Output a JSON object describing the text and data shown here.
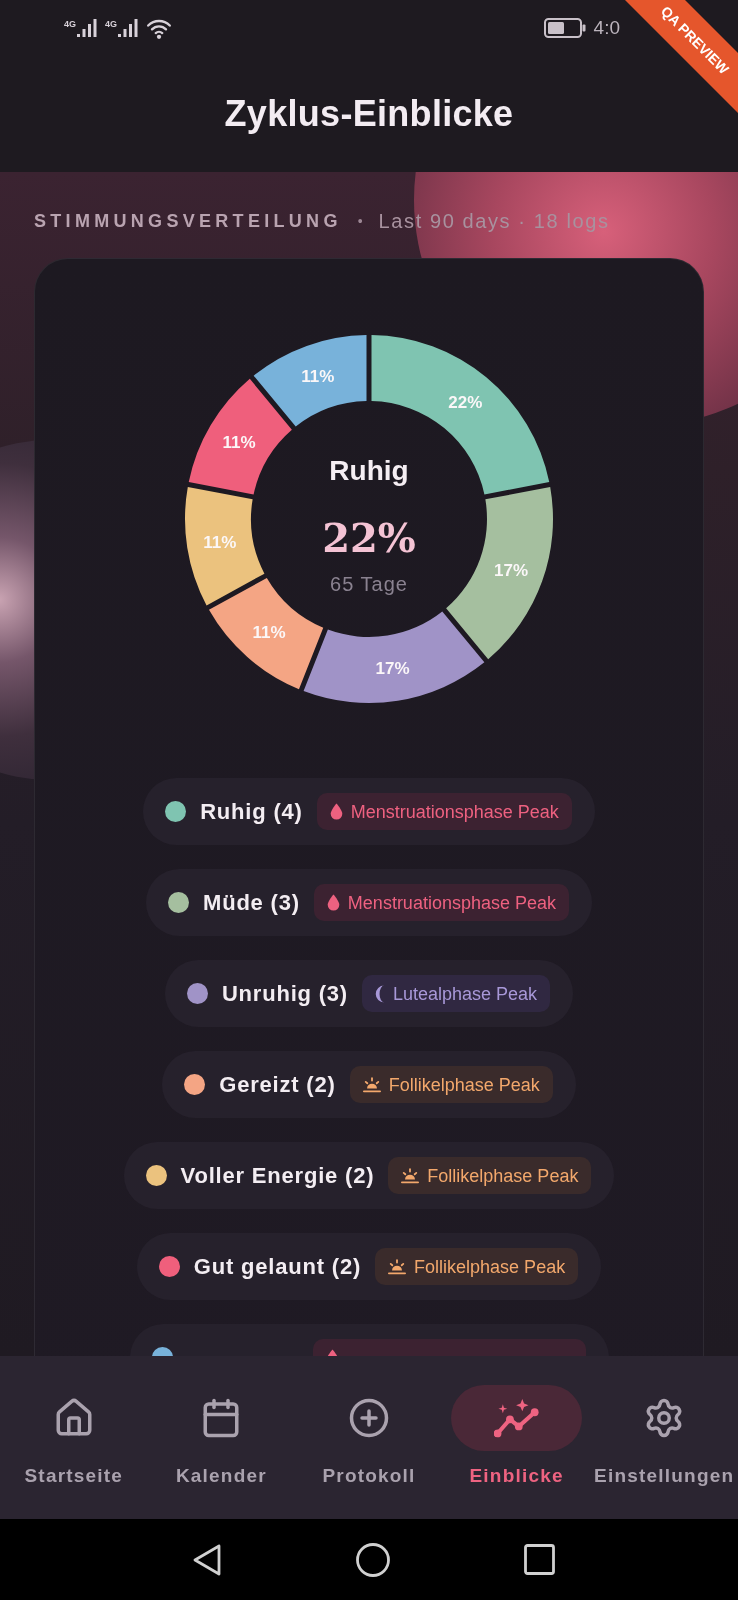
{
  "status_bar": {
    "networks": [
      {
        "label": "4G"
      },
      {
        "label": "4G"
      }
    ],
    "time": "4:0"
  },
  "debug_ribbon": "QA PREVIEW",
  "header": {
    "title": "Zyklus-Einblicke"
  },
  "section": {
    "title": "STIMMUNGSVERTEILUNG",
    "separator": "•",
    "meta": "Last 90 days · 18 logs"
  },
  "chart": {
    "center": {
      "label": "Ruhig",
      "percent": "22%",
      "detail": "65 Tage"
    },
    "chart_data": {
      "type": "donut",
      "values": [
        22,
        17,
        17,
        11,
        11,
        11,
        11
      ],
      "value_labels": [
        "22%",
        "17%",
        "17%",
        "11%",
        "11%",
        "11%",
        "11%"
      ]
    }
  },
  "legend": [
    {
      "label": "Ruhig (4)",
      "color": "#7fc4b1",
      "phase": {
        "kind": "menstrual",
        "label": "Menstruationsphase Peak"
      }
    },
    {
      "label": "Müde (3)",
      "color": "#a5bf9f",
      "phase": {
        "kind": "menstrual",
        "label": "Menstruationsphase Peak"
      }
    },
    {
      "label": "Unruhig (3)",
      "color": "#a093c7",
      "phase": {
        "kind": "luteal",
        "label": "Lutealphase Peak"
      }
    },
    {
      "label": "Gereizt (2)",
      "color": "#f4a584",
      "phase": {
        "kind": "follicular",
        "label": "Follikelphase Peak"
      }
    },
    {
      "label": "Voller Energie (2)",
      "color": "#ebc27e",
      "phase": {
        "kind": "follicular",
        "label": "Follikelphase Peak"
      }
    },
    {
      "label": "Gut gelaunt (2)",
      "color": "#ef5f7c",
      "phase": {
        "kind": "follicular",
        "label": "Follikelphase Peak"
      }
    },
    {
      "color": "#78b2da",
      "phase": {
        "kind": "menstrual"
      }
    }
  ],
  "nav": [
    {
      "label": "Startseite",
      "kind": "home",
      "selected": false
    },
    {
      "label": "Kalender",
      "kind": "calendar",
      "selected": false
    },
    {
      "label": "Protokoll",
      "kind": "log",
      "selected": false
    },
    {
      "label": "Einblicke",
      "kind": "insights",
      "selected": true
    },
    {
      "label": "Einstellungen",
      "kind": "settings",
      "selected": false
    }
  ]
}
